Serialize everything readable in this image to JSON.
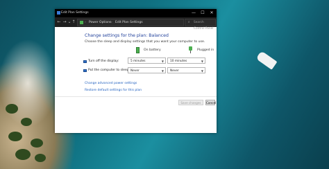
{
  "window": {
    "title": "Edit Plan Settings",
    "controls": {
      "minimize": "—",
      "maximize": "☐",
      "close": "✕"
    }
  },
  "addressbar": {
    "nav": {
      "back": "←",
      "forward": "→",
      "recent": "⌄",
      "up": "↑"
    },
    "breadcrumbs": [
      "Power Options",
      "Edit Plan Settings"
    ],
    "separator": "›",
    "search_placeholder": "Search Control Panel",
    "search_icon": "⌕"
  },
  "content": {
    "heading": "Change settings for the plan: Balanced",
    "subheading": "Choose the sleep and display settings that you want your computer to use.",
    "columns": {
      "battery": "On battery",
      "plugged": "Plugged in"
    },
    "rows": [
      {
        "label": "Turn off the display:",
        "battery": "5 minutes",
        "plugged": "10 minutes"
      },
      {
        "label": "Put the computer to sleep:",
        "battery": "Never",
        "plugged": "Never"
      }
    ],
    "links": {
      "advanced": "Change advanced power settings",
      "restore": "Restore default settings for this plan"
    },
    "buttons": {
      "save": "Save changes",
      "cancel": "Cancel"
    }
  },
  "icons": {
    "battery": "battery-icon",
    "plugged": "plug-icon",
    "display": "monitor-icon",
    "sleep": "moon-icon",
    "app": "control-panel-icon"
  }
}
